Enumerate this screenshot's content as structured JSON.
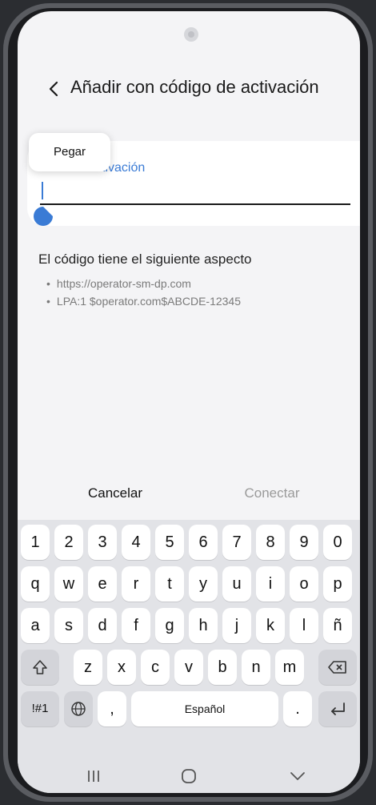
{
  "header": {
    "back_icon": "chevron-left-icon",
    "title": "Añadir con código de activación"
  },
  "field": {
    "label": "Código de activación",
    "label_visible": "ctivación",
    "value": ""
  },
  "popup": {
    "paste_label": "Pegar"
  },
  "hint": {
    "heading": "El código tiene el siguiente aspecto",
    "examples": [
      "https://operator-sm-dp.com",
      "LPA:1 $operator.com$ABCDE-12345"
    ]
  },
  "actions": {
    "cancel_label": "Cancelar",
    "connect_label": "Conectar"
  },
  "keyboard": {
    "row_numbers": [
      "1",
      "2",
      "3",
      "4",
      "5",
      "6",
      "7",
      "8",
      "9",
      "0"
    ],
    "row_qwerty": [
      "q",
      "w",
      "e",
      "r",
      "t",
      "y",
      "u",
      "i",
      "o",
      "p"
    ],
    "row_asdf": [
      "a",
      "s",
      "d",
      "f",
      "g",
      "h",
      "j",
      "k",
      "l",
      "ñ"
    ],
    "row_zxcv": [
      "z",
      "x",
      "c",
      "v",
      "b",
      "n",
      "m"
    ],
    "shift_icon": "shift-icon",
    "backspace_icon": "backspace-icon",
    "symbols_label": "!#1",
    "globe_icon": "globe-icon",
    "comma_label": ",",
    "space_label": "Español",
    "period_label": ".",
    "enter_icon": "enter-icon"
  },
  "navbar": {
    "recents_icon": "recents-icon",
    "home_icon": "home-icon",
    "back_icon": "nav-back-icon"
  },
  "colors": {
    "accent": "#3a7bd5",
    "background": "#f4f4f6",
    "keyboard": "#e2e3e7"
  }
}
